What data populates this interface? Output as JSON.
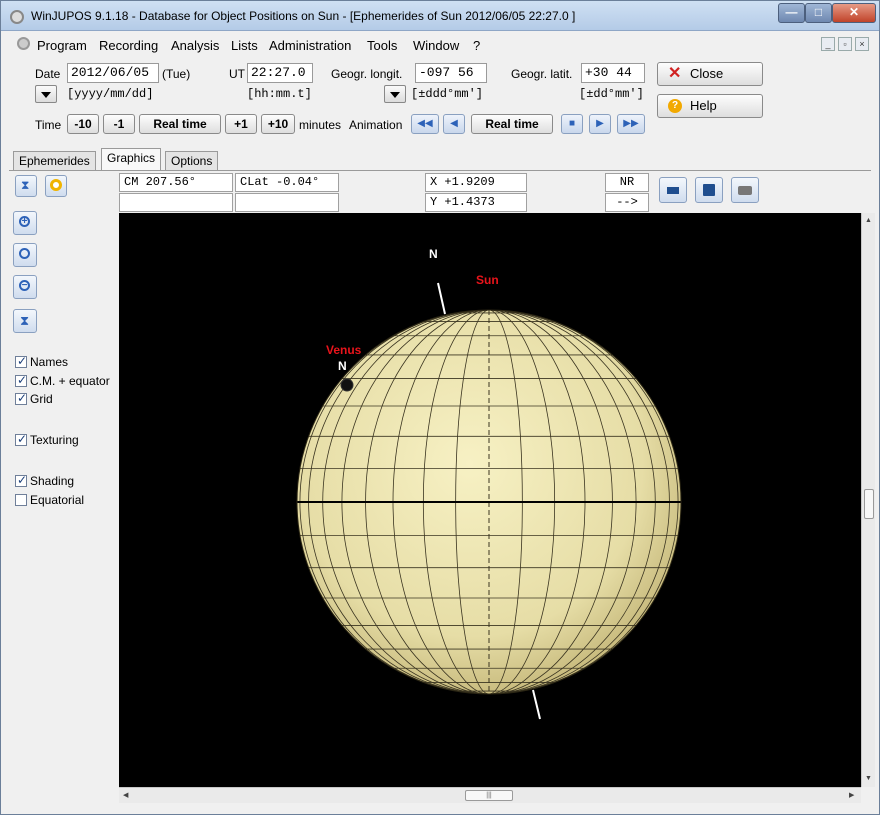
{
  "window": {
    "title": "WinJUPOS 9.1.18 - Database for Object Positions on Sun - [Ephemerides of Sun  2012/06/05  22:27.0 ]",
    "minimize": "—",
    "maximize": "□",
    "close": "✕"
  },
  "menu": {
    "items": [
      "Program",
      "Recording",
      "Analysis",
      "Lists",
      "Administration",
      "Tools",
      "Window",
      "?"
    ],
    "mdi_min": "_",
    "mdi_restore": "▫",
    "mdi_close": "×"
  },
  "controls": {
    "date_label": "Date",
    "date_value": "2012/06/05",
    "day_of_week": "(Tue)",
    "date_format": "[yyyy/mm/dd]",
    "ut_label": "UT",
    "ut_value": "22:27.0",
    "ut_format": "[hh:mm.t]",
    "longit_label": "Geogr. longit.",
    "longit_value": "-097 56",
    "longit_format": "[±ddd°mm']",
    "latit_label": "Geogr. latit.",
    "latit_value": "+30 44",
    "latit_format": "[±dd°mm']",
    "close_label": "Close",
    "help_label": "Help"
  },
  "time_row": {
    "time_label": "Time",
    "minus10": "-10",
    "minus1": "-1",
    "realtime": "Real time",
    "plus1": "+1",
    "plus10": "+10",
    "minutes_label": "minutes",
    "animation_label": "Animation",
    "anim_realtime": "Real time"
  },
  "tabs": [
    "Ephemerides",
    "Graphics",
    "Options"
  ],
  "info": {
    "cm": "CM   207.56°",
    "clat": "CLat  -0.04°",
    "x": "X   +1.9209",
    "y": "Y   +1.4373",
    "nr": "NR",
    "arrow": "-->"
  },
  "options": {
    "names": {
      "label": "Names",
      "checked": true
    },
    "cm_equator": {
      "label": "C.M. + equator",
      "checked": true
    },
    "grid": {
      "label": "Grid",
      "checked": true
    },
    "texturing": {
      "label": "Texturing",
      "checked": true
    },
    "shading": {
      "label": "Shading",
      "checked": true
    },
    "equatorial": {
      "label": "Equatorial",
      "checked": false
    }
  },
  "graphic": {
    "north_label": "N",
    "sun_label": "Sun",
    "venus_label": "Venus",
    "venus_north_label": "N",
    "sun_color": "#e3dba4",
    "label_red": "#e8141b"
  },
  "scrollbar": {
    "thumb_grip": "|||"
  }
}
